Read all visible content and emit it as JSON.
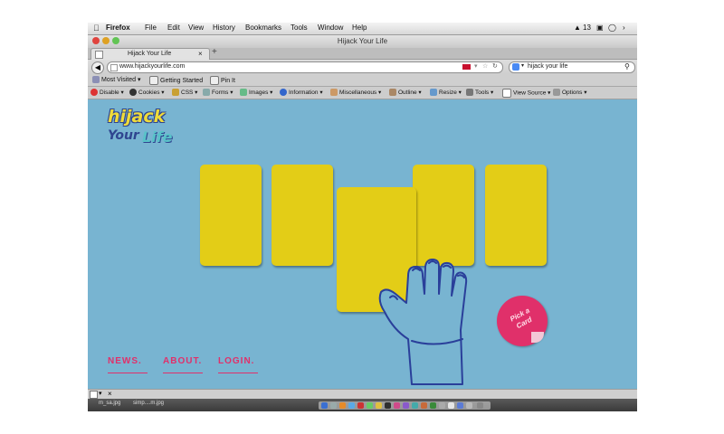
{
  "menubar": {
    "app": "Firefox",
    "items": [
      "File",
      "Edit",
      "View",
      "History",
      "Bookmarks",
      "Tools",
      "Window",
      "Help"
    ],
    "status_count": "13"
  },
  "window": {
    "title": "Hijack Your Life",
    "tab_label": "Hijack Your Life",
    "new_tab": "+"
  },
  "navbar": {
    "url": "www.hijackyourlife.com",
    "search_value": "hijack your life"
  },
  "bookmarks": {
    "items": [
      "Most Visited",
      "Getting Started",
      "Pin It"
    ]
  },
  "devbar": {
    "items": [
      "Disable",
      "Cookies",
      "CSS",
      "Forms",
      "Images",
      "Information",
      "Miscellaneous",
      "Outline",
      "Resize",
      "Tools",
      "View Source",
      "Options"
    ]
  },
  "page": {
    "logo_line1": "hijack",
    "logo_line2a": "Your",
    "logo_line2b": "Life",
    "sticker_line1": "Pick a",
    "sticker_line2": "Card",
    "nav": [
      "NEWS.",
      "ABOUT.",
      "LOGIN."
    ]
  },
  "colors": {
    "background": "#78b4d1",
    "card": "#e3cd17",
    "accent": "#e0306a",
    "hand_outline": "#2a3f9a"
  },
  "statusbar": {
    "text1": "m_sa.jpg",
    "text2": "simp....m.jpg"
  }
}
